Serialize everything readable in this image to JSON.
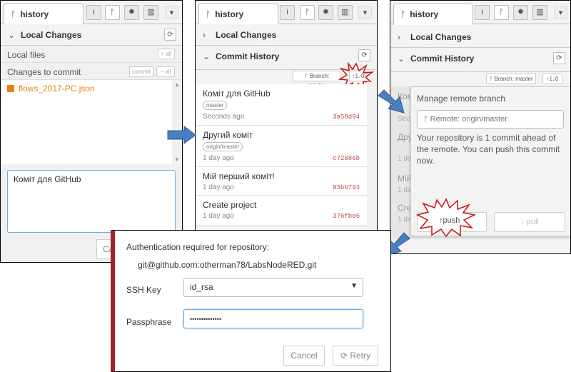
{
  "panel1": {
    "tab_label": "history",
    "section_local_changes": "Local Changes",
    "local_files_label": "Local files",
    "add_all_label": "+ all",
    "changes_to_commit_label": "Changes to commit",
    "commit_button_label": "commit",
    "remove_all_label": "− all",
    "file_name": "flows_2017-PC.json",
    "commit_message": "Коміт для GitHub",
    "cancel_partial": "Ca"
  },
  "panel2": {
    "tab_label": "history",
    "section_local_changes": "Local Changes",
    "section_commit_history": "Commit History",
    "branch_label": "Branch: master",
    "ahead_behind": "1↓0",
    "commits": [
      {
        "message": "Коміт для GitHub",
        "badge": "master",
        "time": "Seconds ago",
        "hash": "3a58d94"
      },
      {
        "message": "Другий коміт",
        "badge": "origin/master",
        "time": "1 day ago",
        "hash": "c72086b"
      },
      {
        "message": "Мій перший коміт!",
        "badge": "",
        "time": "1 day ago",
        "hash": "03bb793"
      },
      {
        "message": "Create project",
        "badge": "",
        "time": "1 day ago",
        "hash": "376fbe6"
      }
    ]
  },
  "panel3": {
    "tab_label": "history",
    "section_local_changes": "Local Changes",
    "section_commit_history": "Commit History",
    "branch_label": "Branch: master",
    "ahead_behind": "1↓0",
    "popup_title": "Manage remote branch",
    "remote_label": "Remote: origin/master",
    "info_text": "Your repository is 1 commit ahead of the remote. You can push this commit now.",
    "push_label": "push",
    "pull_label": "pull",
    "peek_lines": [
      "Ком",
      "Seco",
      "Друг",
      "1 da",
      "Мій",
      "1 da",
      "Cre",
      "1 da"
    ]
  },
  "auth_dialog": {
    "title": "Authentication required for repository:",
    "repo": "git@github.com:otherman78/LabsNodeRED.git",
    "ssh_key_label": "SSH Key",
    "ssh_key_value": "id_rsa",
    "passphrase_label": "Passphrase",
    "passphrase_value": "••••••••••••••",
    "cancel_label": "Cancel",
    "retry_label": "Retry"
  },
  "colors": {
    "accent_arrow": "#4a7ec0",
    "file_orange": "#e8820c",
    "burst_red": "#cc1111",
    "dialog_stripe": "#aa1f2e"
  },
  "icons": {
    "branch": "ᚠ",
    "info": "i",
    "bug": "✹",
    "chart": "▥",
    "chevron_down": "▾",
    "chevron_right": "›",
    "refresh": "⟳"
  }
}
